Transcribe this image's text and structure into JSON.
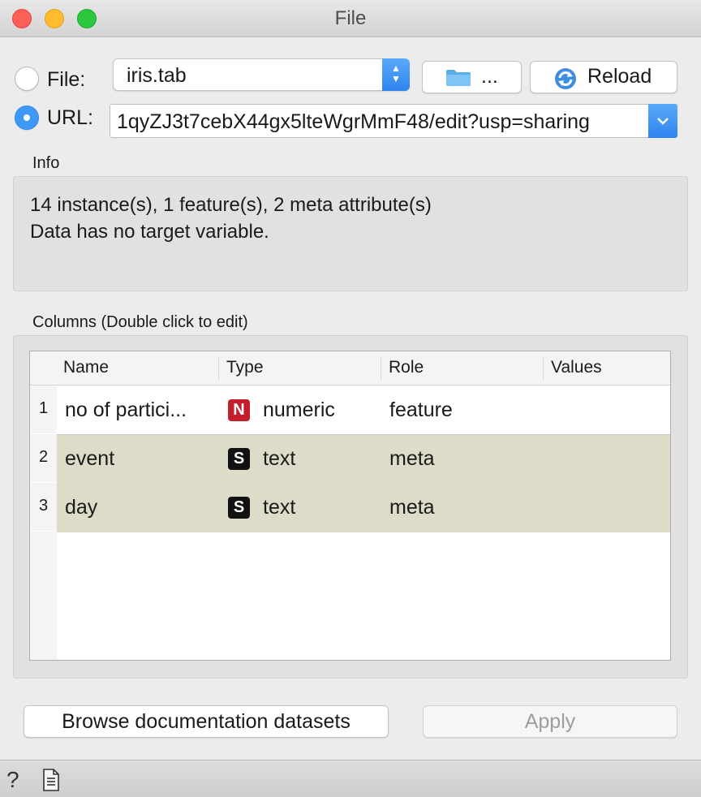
{
  "window": {
    "title": "File"
  },
  "source": {
    "file_label": "File:",
    "url_label": "URL:",
    "file_value": "iris.tab",
    "browse_label": "...",
    "reload_label": "Reload",
    "url_value": "1qyZJ3t7cebX44gx5lteWgrMmF48/edit?usp=sharing",
    "selected": "url"
  },
  "info": {
    "title": "Info",
    "line1": "14 instance(s), 1 feature(s), 2 meta attribute(s)",
    "line2": "Data has no target variable."
  },
  "columns": {
    "title": "Columns (Double click to edit)",
    "headers": [
      "Name",
      "Type",
      "Role",
      "Values"
    ],
    "rows": [
      {
        "num": "1",
        "name": "no of partici...",
        "type_badge": "N",
        "type": "numeric",
        "role": "feature",
        "values": ""
      },
      {
        "num": "2",
        "name": "event",
        "type_badge": "S",
        "type": "text",
        "role": "meta",
        "values": ""
      },
      {
        "num": "3",
        "name": "day",
        "type_badge": "S",
        "type": "text",
        "role": "meta",
        "values": ""
      }
    ]
  },
  "buttons": {
    "browse_docs": "Browse documentation datasets",
    "apply": "Apply"
  },
  "colors": {
    "accent": "#3f98f8",
    "meta_row": "#dcdcc8",
    "numeric_badge": "#c41e2c",
    "text_badge": "#111111"
  },
  "icons": [
    "question-icon",
    "report-icon",
    "folder-icon",
    "reload-icon"
  ]
}
